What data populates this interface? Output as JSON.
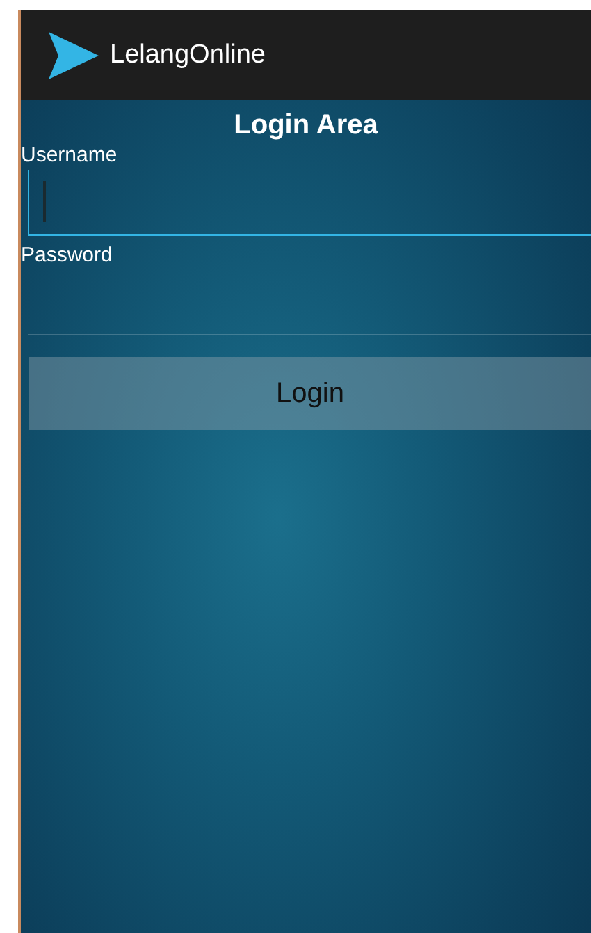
{
  "app_bar": {
    "title": "LelangOnline"
  },
  "heading": "Login Area",
  "fields": [
    {
      "label": "Username",
      "focused": true
    },
    {
      "label": "Password",
      "focused": false
    }
  ],
  "login_button": "Login"
}
